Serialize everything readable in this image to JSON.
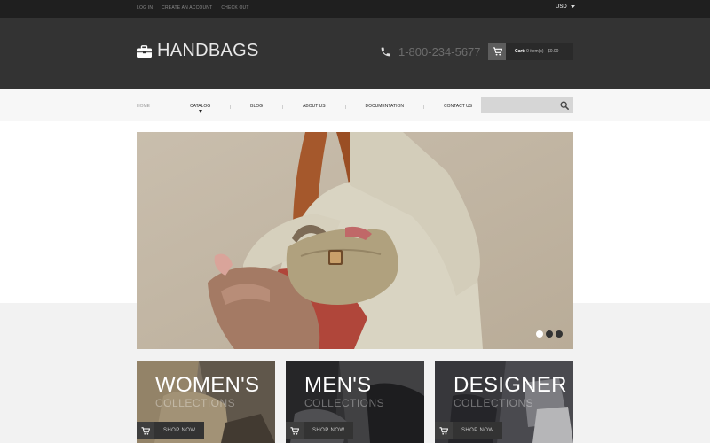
{
  "topbar": {
    "links": [
      "LOG IN",
      "CREATE AN ACCOUNT",
      "CHECK OUT"
    ],
    "currency": "USD"
  },
  "header": {
    "logo_text": "HANDBAGS",
    "phone": "1-800-234-5677",
    "cart_label": "Cart:",
    "cart_value": "0 item(s) - $0.00"
  },
  "nav": {
    "items": [
      "HOME",
      "CATALOG",
      "BLOG",
      "ABOUT US",
      "DOCUMENTATION",
      "CONTACT US"
    ]
  },
  "search": {
    "placeholder": ""
  },
  "banners": [
    {
      "title": "WOMEN'S",
      "subtitle": "COLLECTIONS",
      "button": "SHOP NOW"
    },
    {
      "title": "MEN'S",
      "subtitle": "COLLECTIONS",
      "button": "SHOP NOW"
    },
    {
      "title": "DESIGNER",
      "subtitle": "COLLECTIONS",
      "button": "SHOP NOW"
    }
  ],
  "slider": {
    "slides": 3,
    "active_slide": 1
  },
  "colors": {
    "topbar": "#1f1f1f",
    "header": "#333333",
    "nav": "#f7f7f7",
    "accent_dark": "#333333"
  }
}
